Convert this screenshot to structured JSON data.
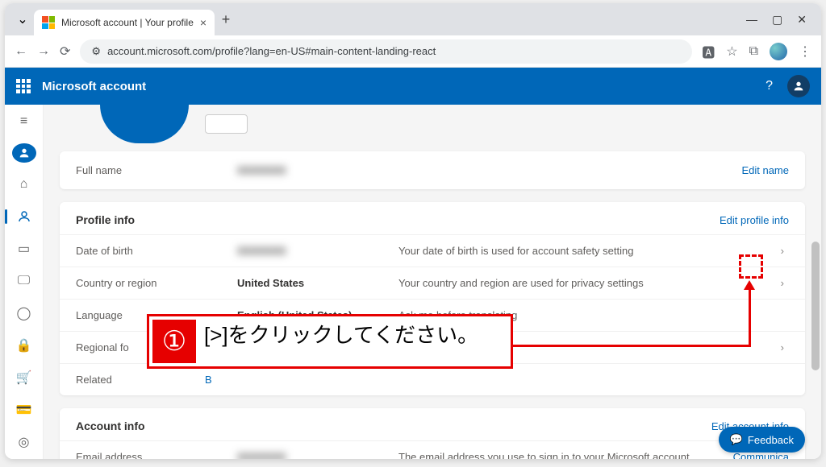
{
  "browser": {
    "tab_title": "Microsoft account | Your profile",
    "url": "account.microsoft.com/profile?lang=en-US#main-content-landing-react"
  },
  "header": {
    "title": "Microsoft account"
  },
  "fullname": {
    "label": "Full name",
    "value": "XXXXXXX",
    "edit": "Edit name"
  },
  "profile": {
    "section_title": "Profile info",
    "edit": "Edit profile info",
    "rows": [
      {
        "label": "Date of birth",
        "value": "XXXXXXX",
        "desc": "Your date of birth is used for account safety setting",
        "blur_value": true,
        "chevron": true
      },
      {
        "label": "Country or region",
        "value": "United States",
        "desc": "Your country and region are used for privacy settings",
        "chevron": true
      },
      {
        "label": "Language",
        "value": "English (United States)",
        "desc": "Ask me before translating",
        "chevron": false
      },
      {
        "label": "Regional fo",
        "value": "",
        "desc": "",
        "chevron": true
      }
    ],
    "related_label": "Related",
    "related_link": "B"
  },
  "account": {
    "section_title": "Account info",
    "edit": "Edit account info",
    "rows": [
      {
        "label": "Email address",
        "value": "XXXXXXX",
        "desc": "The email address you use to sign in to your Microsoft account",
        "action": "Communica"
      }
    ]
  },
  "feedback": "Feedback",
  "annotation": {
    "badge": "①",
    "text": "[>]をクリックしてください。"
  }
}
